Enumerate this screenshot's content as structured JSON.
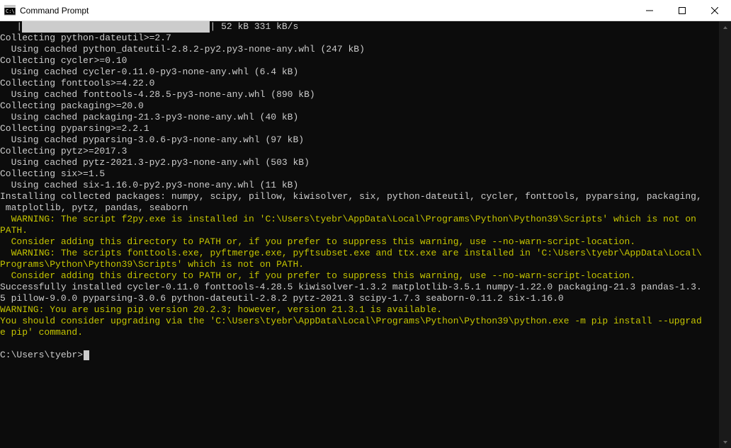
{
  "window": {
    "title": "Command Prompt"
  },
  "progress": {
    "leading": "   |",
    "filled": "                                  ",
    "trailing": "| 52 kB 331 kB/s"
  },
  "lines": [
    {
      "cls": "white",
      "text": "Collecting python-dateutil>=2.7"
    },
    {
      "cls": "white",
      "text": "  Using cached python_dateutil-2.8.2-py2.py3-none-any.whl (247 kB)"
    },
    {
      "cls": "white",
      "text": "Collecting cycler>=0.10"
    },
    {
      "cls": "white",
      "text": "  Using cached cycler-0.11.0-py3-none-any.whl (6.4 kB)"
    },
    {
      "cls": "white",
      "text": "Collecting fonttools>=4.22.0"
    },
    {
      "cls": "white",
      "text": "  Using cached fonttools-4.28.5-py3-none-any.whl (890 kB)"
    },
    {
      "cls": "white",
      "text": "Collecting packaging>=20.0"
    },
    {
      "cls": "white",
      "text": "  Using cached packaging-21.3-py3-none-any.whl (40 kB)"
    },
    {
      "cls": "white",
      "text": "Collecting pyparsing>=2.2.1"
    },
    {
      "cls": "white",
      "text": "  Using cached pyparsing-3.0.6-py3-none-any.whl (97 kB)"
    },
    {
      "cls": "white",
      "text": "Collecting pytz>=2017.3"
    },
    {
      "cls": "white",
      "text": "  Using cached pytz-2021.3-py2.py3-none-any.whl (503 kB)"
    },
    {
      "cls": "white",
      "text": "Collecting six>=1.5"
    },
    {
      "cls": "white",
      "text": "  Using cached six-1.16.0-py2.py3-none-any.whl (11 kB)"
    },
    {
      "cls": "white",
      "text": "Installing collected packages: numpy, scipy, pillow, kiwisolver, six, python-dateutil, cycler, fonttools, pyparsing, packaging,"
    },
    {
      "cls": "white",
      "text": " matplotlib, pytz, pandas, seaborn"
    },
    {
      "cls": "yellow",
      "text": "  WARNING: The script f2py.exe is installed in 'C:\\Users\\tyebr\\AppData\\Local\\Programs\\Python\\Python39\\Scripts' which is not on "
    },
    {
      "cls": "yellow",
      "text": "PATH."
    },
    {
      "cls": "yellow",
      "text": "  Consider adding this directory to PATH or, if you prefer to suppress this warning, use --no-warn-script-location."
    },
    {
      "cls": "yellow",
      "text": "  WARNING: The scripts fonttools.exe, pyftmerge.exe, pyftsubset.exe and ttx.exe are installed in 'C:\\Users\\tyebr\\AppData\\Local\\"
    },
    {
      "cls": "yellow",
      "text": "Programs\\Python\\Python39\\Scripts' which is not on PATH."
    },
    {
      "cls": "yellow",
      "text": "  Consider adding this directory to PATH or, if you prefer to suppress this warning, use --no-warn-script-location."
    },
    {
      "cls": "white",
      "text": "Successfully installed cycler-0.11.0 fonttools-4.28.5 kiwisolver-1.3.2 matplotlib-3.5.1 numpy-1.22.0 packaging-21.3 pandas-1.3."
    },
    {
      "cls": "white",
      "text": "5 pillow-9.0.0 pyparsing-3.0.6 python-dateutil-2.8.2 pytz-2021.3 scipy-1.7.3 seaborn-0.11.2 six-1.16.0"
    },
    {
      "cls": "yellow",
      "text": "WARNING: You are using pip version 20.2.3; however, version 21.3.1 is available."
    },
    {
      "cls": "yellow",
      "text": "You should consider upgrading via the 'C:\\Users\\tyebr\\AppData\\Local\\Programs\\Python\\Python39\\python.exe -m pip install --upgrad"
    },
    {
      "cls": "yellow",
      "text": "e pip' command."
    },
    {
      "cls": "white",
      "text": ""
    }
  ],
  "prompt": "C:\\Users\\tyebr>"
}
